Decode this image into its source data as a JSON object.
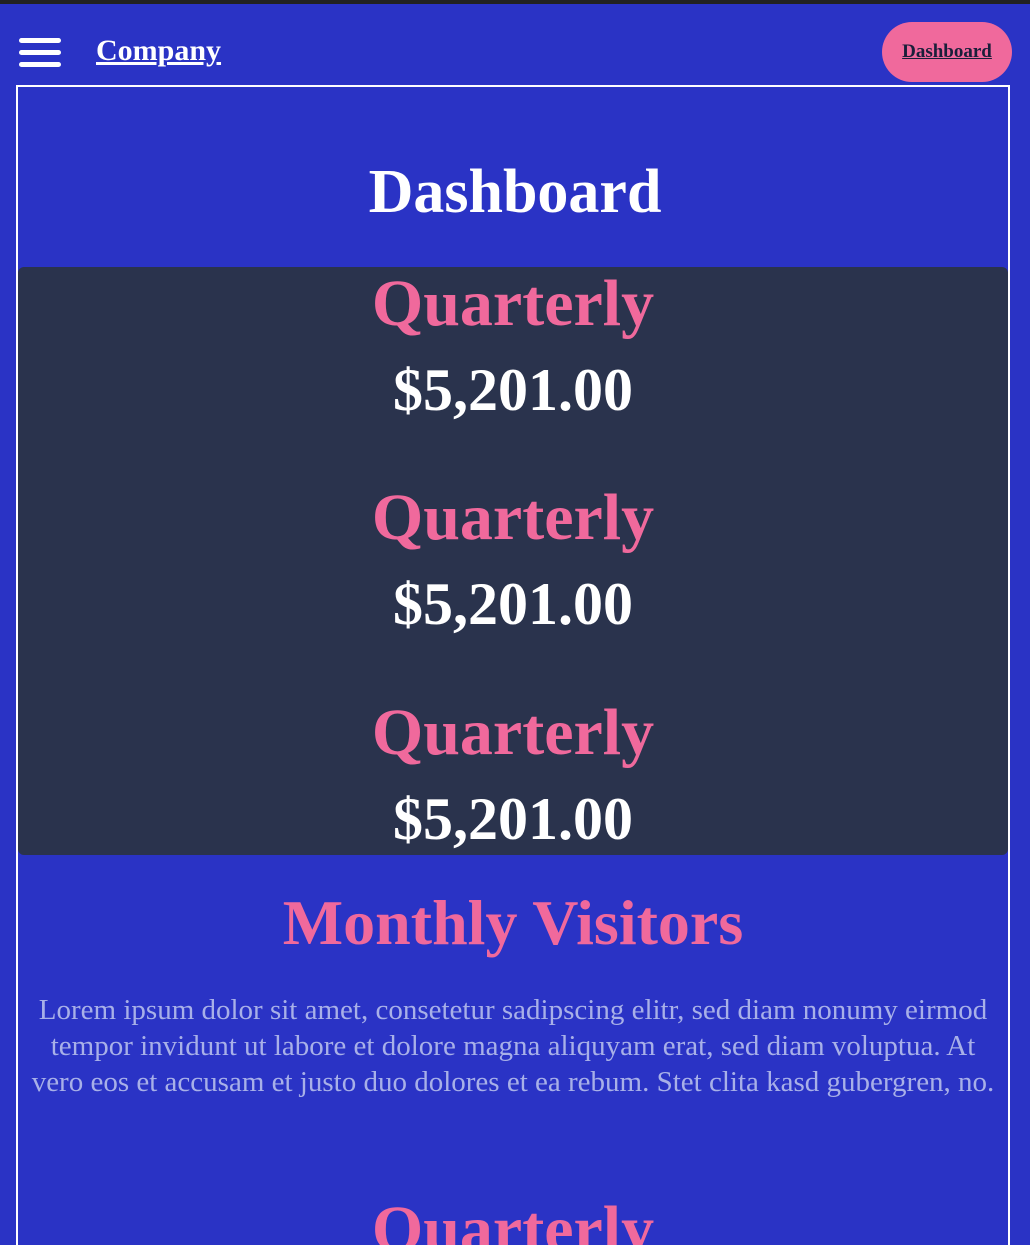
{
  "navbar": {
    "brand": "Company",
    "button_label": "Dashboard"
  },
  "main": {
    "title": "Dashboard",
    "stats": [
      {
        "label": "Quarterly",
        "value": "$5,201.00"
      },
      {
        "label": "Quarterly",
        "value": "$5,201.00"
      },
      {
        "label": "Quarterly",
        "value": "$5,201.00"
      }
    ],
    "visitors_title": "Monthly Visitors",
    "visitors_text": "Lorem ipsum dolor sit amet, consetetur sadipscing elitr, sed diam nonumy eirmod tempor invidunt ut labore et dolore magna aliquyam erat, sed diam voluptua. At vero eos et accusam et justo duo dolores et ea rebum. Stet clita kasd gubergren, no.",
    "next_heading": "Quarterly"
  },
  "colors": {
    "background": "#2a33c5",
    "panel": "#2a334d",
    "accent": "#f0699c",
    "text": "#ffffff",
    "muted_text": "#a8b0e8"
  }
}
